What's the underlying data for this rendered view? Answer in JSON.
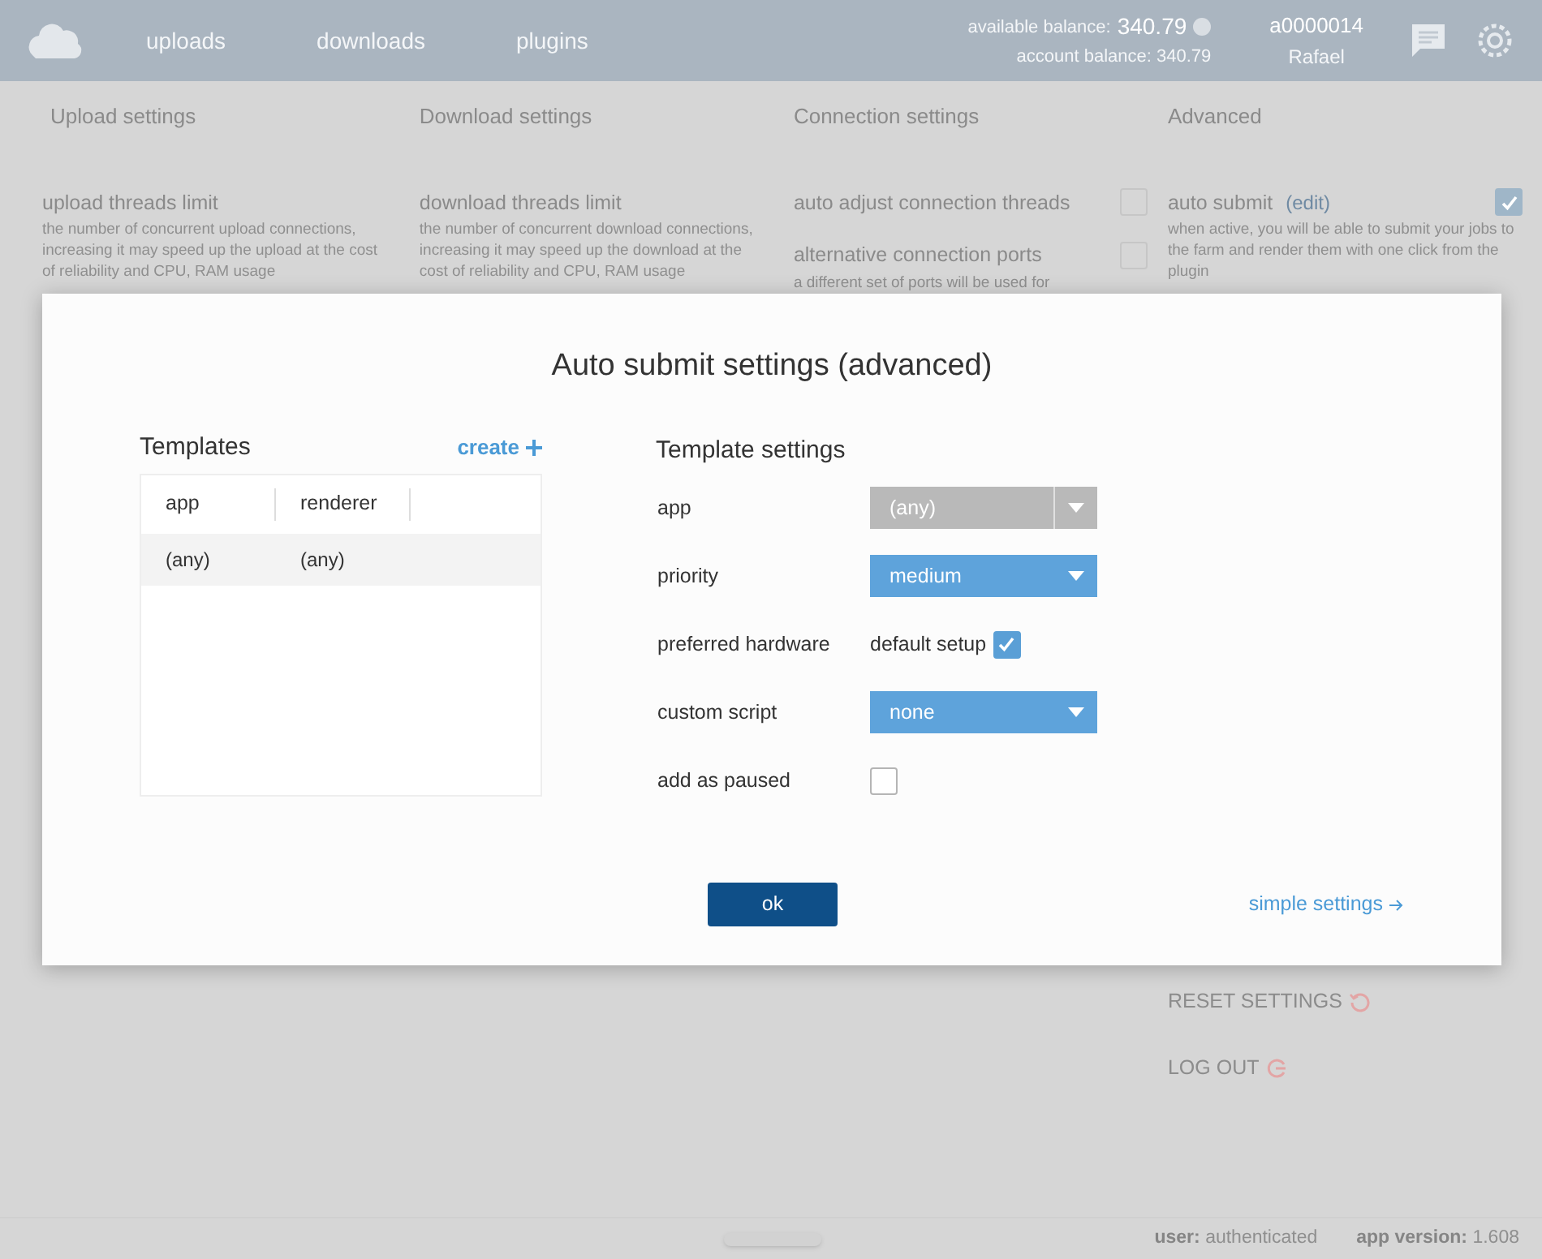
{
  "header": {
    "nav": [
      {
        "label": "uploads",
        "selected": false
      },
      {
        "label": "downloads",
        "selected": false
      },
      {
        "label": "plugins",
        "selected": false
      }
    ],
    "available_balance_label": "available balance:",
    "available_balance": "340.79",
    "account_balance": "account balance:  340.79",
    "account_id": "a0000014",
    "user_name": "Rafael"
  },
  "columns": [
    {
      "title": "Upload settings",
      "items": [
        {
          "kind": "field",
          "label": "upload threads limit",
          "description": "the number of concurrent upload connections, increasing it may speed up the upload at the cost of reliability and CPU, RAM usage"
        }
      ]
    },
    {
      "title": "Download settings",
      "items": [
        {
          "kind": "field",
          "label": "download threads limit",
          "description": "the number of concurrent download connections, increasing it may speed up the download at the cost of reliability and CPU, RAM usage"
        }
      ]
    },
    {
      "title": "Connection settings",
      "items": [
        {
          "kind": "checkbox",
          "label": "auto adjust connection threads",
          "checked": false
        },
        {
          "kind": "checkbox",
          "label": "alternative connection ports",
          "checked": false,
          "description": "a different set of ports will be used for"
        }
      ]
    },
    {
      "title": "Advanced",
      "items": [
        {
          "kind": "checkbox",
          "label": "auto submit",
          "link": "(edit)",
          "checked": true,
          "description": "when active, you will be able to submit your jobs to the farm and render them with one click from the plugin"
        }
      ]
    }
  ],
  "actions": [
    {
      "kind": "reset",
      "label": "RESET SETTINGS"
    },
    {
      "kind": "logout",
      "label": "LOG OUT"
    }
  ],
  "status_bar": {
    "user_label": "user:",
    "user": "authenticated",
    "version_label": "app version:",
    "version": "1.608"
  },
  "dialog": {
    "title": "Auto submit settings (advanced)",
    "templates": {
      "title": "Templates",
      "create": "create",
      "columns": [
        "app",
        "renderer"
      ],
      "rows": [
        {
          "cells": [
            "(any)",
            "(any)"
          ],
          "selected": true
        }
      ]
    },
    "settings_title": "Template settings",
    "settings": [
      {
        "kind": "select",
        "label": "app",
        "value": "(any)",
        "disabled": true
      },
      {
        "kind": "select",
        "label": "priority",
        "value": "medium",
        "disabled": false
      },
      {
        "kind": "labeled_checkbox",
        "label": "preferred hardware",
        "option": "default setup",
        "checked": true
      },
      {
        "kind": "select",
        "label": "custom script",
        "value": "none",
        "disabled": false
      },
      {
        "kind": "checkbox",
        "label": "add as paused",
        "checked": false
      }
    ],
    "ok": "ok",
    "simple_settings": "simple settings"
  }
}
